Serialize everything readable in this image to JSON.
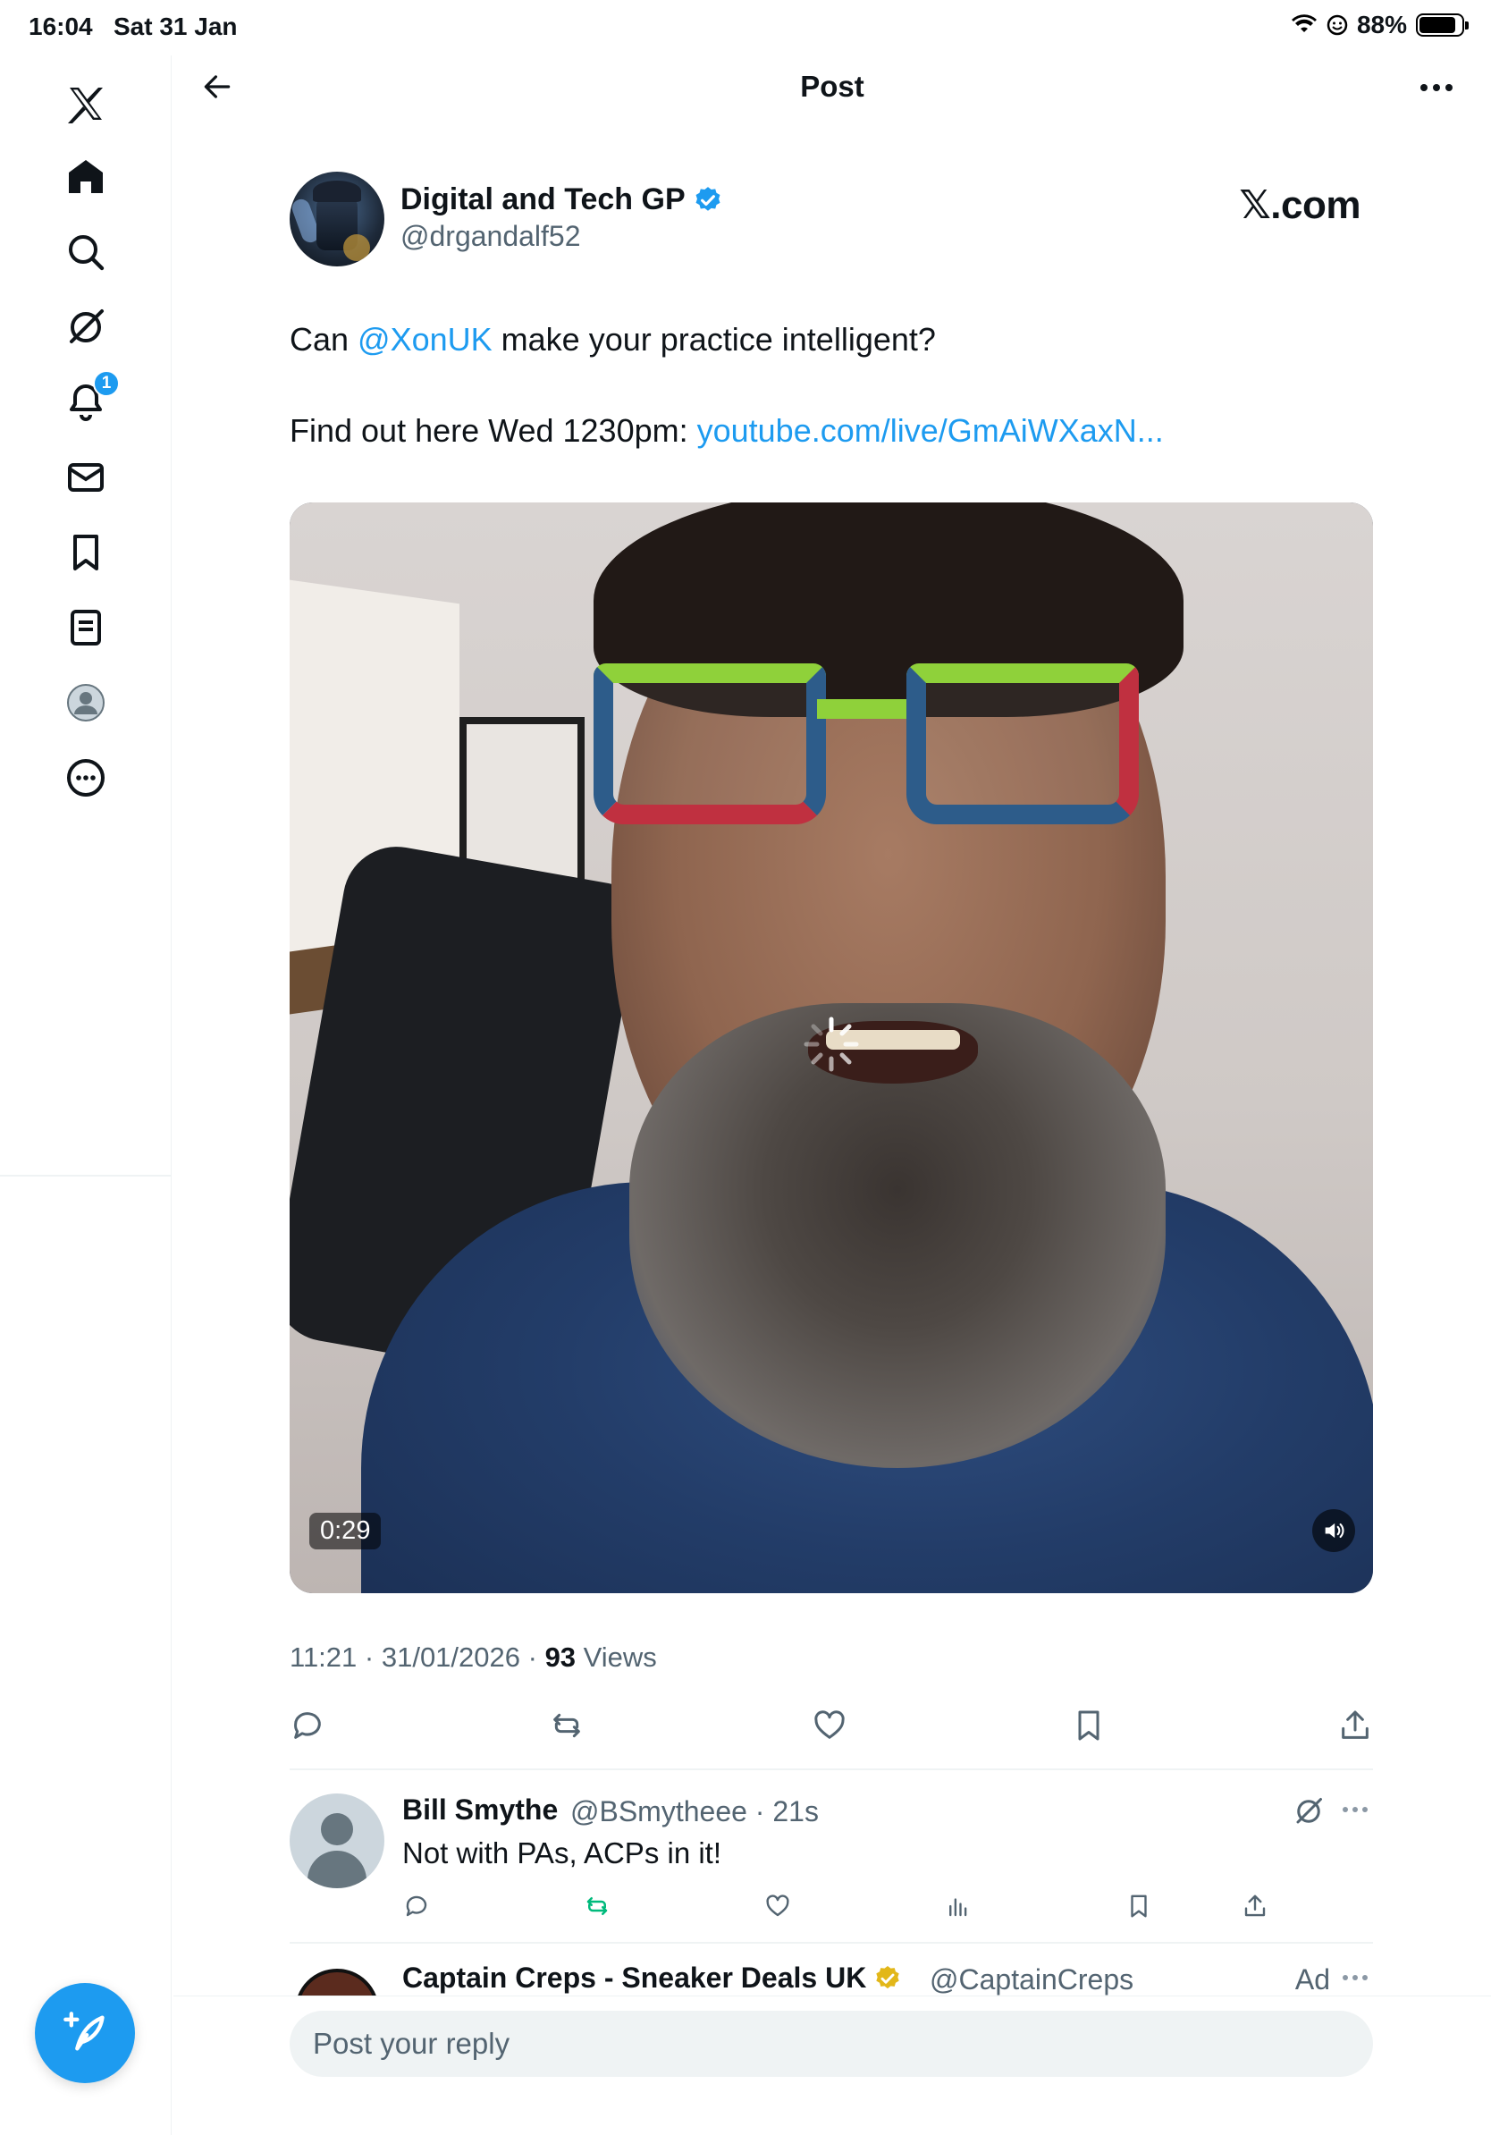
{
  "status_bar": {
    "time": "16:04",
    "date": "Sat 31 Jan",
    "battery": "88%",
    "icons": [
      "wifi-icon",
      "face-icon",
      "battery-icon"
    ]
  },
  "sidebar": {
    "items": [
      {
        "name": "x-logo",
        "icon": "x-logo-icon"
      },
      {
        "name": "home",
        "icon": "home-icon"
      },
      {
        "name": "search",
        "icon": "search-icon"
      },
      {
        "name": "grok",
        "icon": "grok-icon"
      },
      {
        "name": "notifications",
        "icon": "bell-icon",
        "badge": "1"
      },
      {
        "name": "messages",
        "icon": "envelope-icon"
      },
      {
        "name": "bookmarks",
        "icon": "bookmark-icon"
      },
      {
        "name": "lists",
        "icon": "list-icon"
      },
      {
        "name": "profile",
        "icon": "avatar-icon"
      },
      {
        "name": "more",
        "icon": "more-circle-icon"
      }
    ],
    "compose_icon": "feather-plus-icon"
  },
  "header": {
    "title": "Post",
    "back_icon": "arrow-left-icon",
    "more_icon": "ellipsis-icon"
  },
  "post": {
    "author_name": "Digital and Tech GP",
    "author_handle": "@drgandalf52",
    "source_badge": "𝕏.com",
    "text_prefix": "Can ",
    "mention": "@XonUK",
    "text_suffix": " make your practice intelligent?",
    "line2_prefix": "Find out here Wed 1230pm: ",
    "link": "youtube.com/live/GmAiWXaxN...",
    "video_duration": "0:29",
    "time": "11:21",
    "date": "31/01/2026",
    "views_count": "93",
    "views_label": "Views",
    "colors": {
      "accent": "#1d9bf0",
      "text": "#0f1419",
      "muted": "#536471",
      "retweet_active": "#00ba7c"
    }
  },
  "reply": {
    "name": "Bill Smythe",
    "handle": "@BSmytheee · 21s",
    "text": "Not with PAs, ACPs in it!"
  },
  "ad": {
    "name": "Captain Creps - Sneaker Deals UK",
    "handle": "@CaptainCreps",
    "label": "Ad"
  },
  "composer": {
    "placeholder": "Post your reply"
  }
}
